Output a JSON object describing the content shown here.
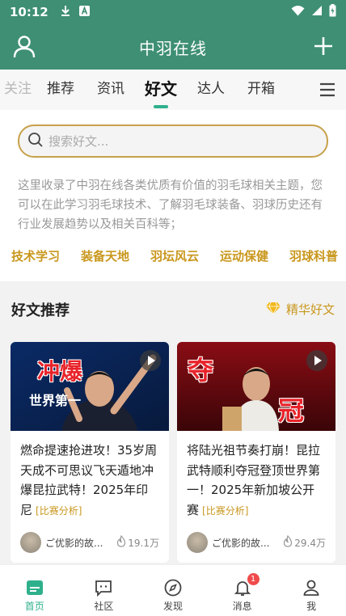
{
  "status_bar": {
    "time": "10:12",
    "icons": [
      "download-icon",
      "a-icon",
      "wifi-icon",
      "signal-icon",
      "battery-icon"
    ]
  },
  "header": {
    "title": "中羽在线",
    "left_icon": "user-icon",
    "right_icon": "plus-icon"
  },
  "tabs": [
    {
      "label": "关注"
    },
    {
      "label": "推荐"
    },
    {
      "label": "资讯"
    },
    {
      "label": "好文"
    },
    {
      "label": "达人"
    },
    {
      "label": "开箱"
    }
  ],
  "active_tab": "好文",
  "search": {
    "placeholder": "搜索好文..."
  },
  "description": "这里收录了中羽在线各类优质有价值的羽毛球相关主题，您可以在此学习羽毛球技术、了解羽毛球装备、羽球历史还有行业发展趋势以及相关百科等；",
  "categories": [
    "技术学习",
    "装备天地",
    "羽坛风云",
    "运动保健",
    "羽球科普"
  ],
  "section": {
    "title": "好文推荐",
    "link": "精华好文"
  },
  "articles": [
    {
      "thumb_text": [
        "冲爆",
        "世界第一"
      ],
      "title": "燃命提速抢进攻！35岁周天成不可思议飞天遁地冲爆昆拉武特！2025年印尼",
      "tag": "[比赛分析]",
      "author": "ご优影的故...",
      "views": "19.1万"
    },
    {
      "thumb_text": [
        "夺",
        "冠"
      ],
      "title": "将陆光祖节奏打崩！昆拉武特顺利夺冠登顶世界第一！2025年新加坡公开赛",
      "tag": "[比赛分析]",
      "author": "ご优影的故...",
      "views": "29.4万"
    }
  ],
  "bottom_nav": [
    {
      "label": "首页",
      "icon": "home-icon"
    },
    {
      "label": "社区",
      "icon": "community-icon"
    },
    {
      "label": "发现",
      "icon": "compass-icon"
    },
    {
      "label": "消息",
      "icon": "bell-icon",
      "badge": "1"
    },
    {
      "label": "我",
      "icon": "person-icon"
    }
  ],
  "colors": {
    "brand_green": "#3e8f73",
    "accent_green": "#2fb08c",
    "gold": "#c9971d",
    "badge_red": "#f04b4b"
  }
}
